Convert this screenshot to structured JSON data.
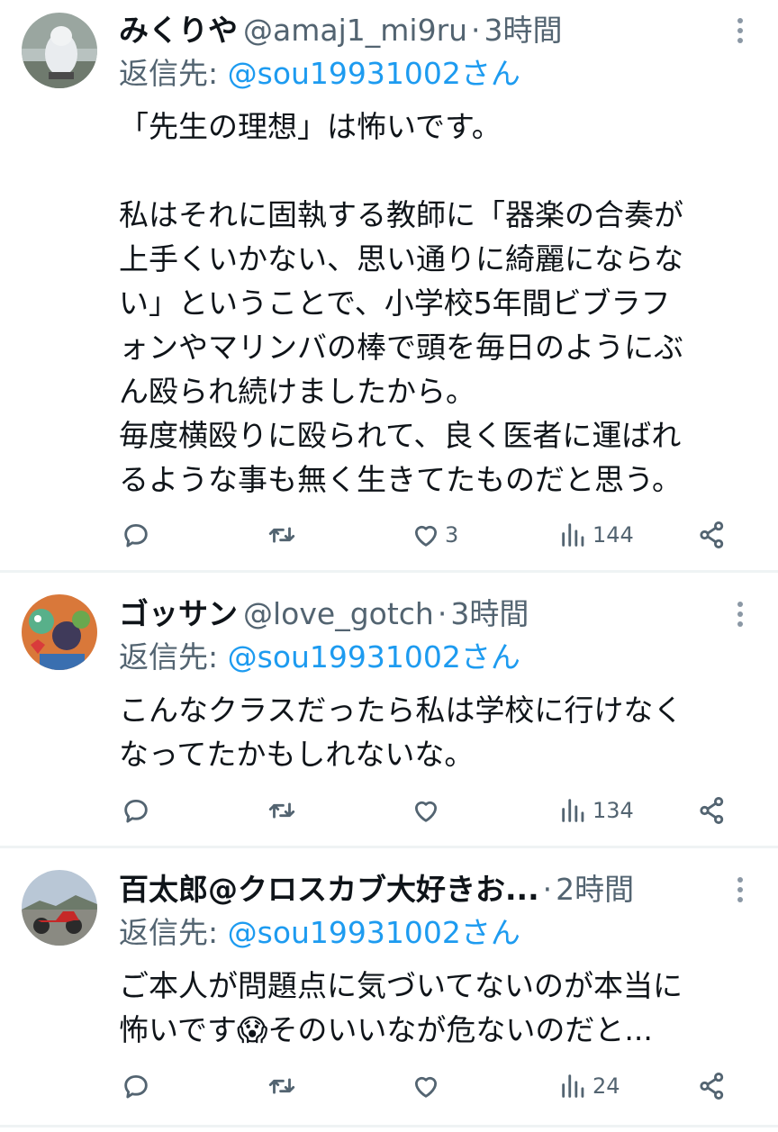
{
  "tweets": [
    {
      "name": "みくりや",
      "handle": "@amaj1_mi9ru",
      "separator": "·",
      "time": "3時間",
      "reply_label": "返信先:",
      "reply_mention": "@sou19931002さん",
      "lines": [
        "「先生の理想」は怖いです。",
        "",
        "私はそれに固執する教師に「器楽の合奏が",
        "上手くいかない、思い通りに綺麗にならな",
        "い」ということで、小学校5年間ビブラフ",
        "ォンやマリンバの棒で頭を毎日のようにぶ",
        "ん殴られ続けましたから。",
        "毎度横殴りに殴られて、良く医者に運ばれ",
        "るような事も無く生きてたものだと思う。"
      ],
      "likes": "3",
      "views": "144"
    },
    {
      "name": "ゴッサン",
      "handle": "@love_gotch",
      "separator": "·",
      "time": "3時間",
      "reply_label": "返信先:",
      "reply_mention": "@sou19931002さん",
      "lines": [
        "こんなクラスだったら私は学校に行けなく",
        "なってたかもしれないな。"
      ],
      "likes": "",
      "views": "134"
    },
    {
      "name": "百太郎@クロスカブ大好きお...",
      "handle": "",
      "separator": "·",
      "time": "2時間",
      "reply_label": "返信先:",
      "reply_mention": "@sou19931002さん",
      "lines": [
        "ご本人が問題点に気づいてないのが本当に",
        "怖いです😱そのいいなが危ないのだと..."
      ],
      "likes": "",
      "views": "24"
    }
  ],
  "icons": {
    "reply": "reply-icon",
    "retweet": "retweet-icon",
    "like": "heart-icon",
    "views": "views-icon",
    "share": "share-icon",
    "more": "more-icon"
  },
  "colors": {
    "link": "#1d9bf0",
    "muted": "#536471",
    "text": "#0f1419"
  }
}
